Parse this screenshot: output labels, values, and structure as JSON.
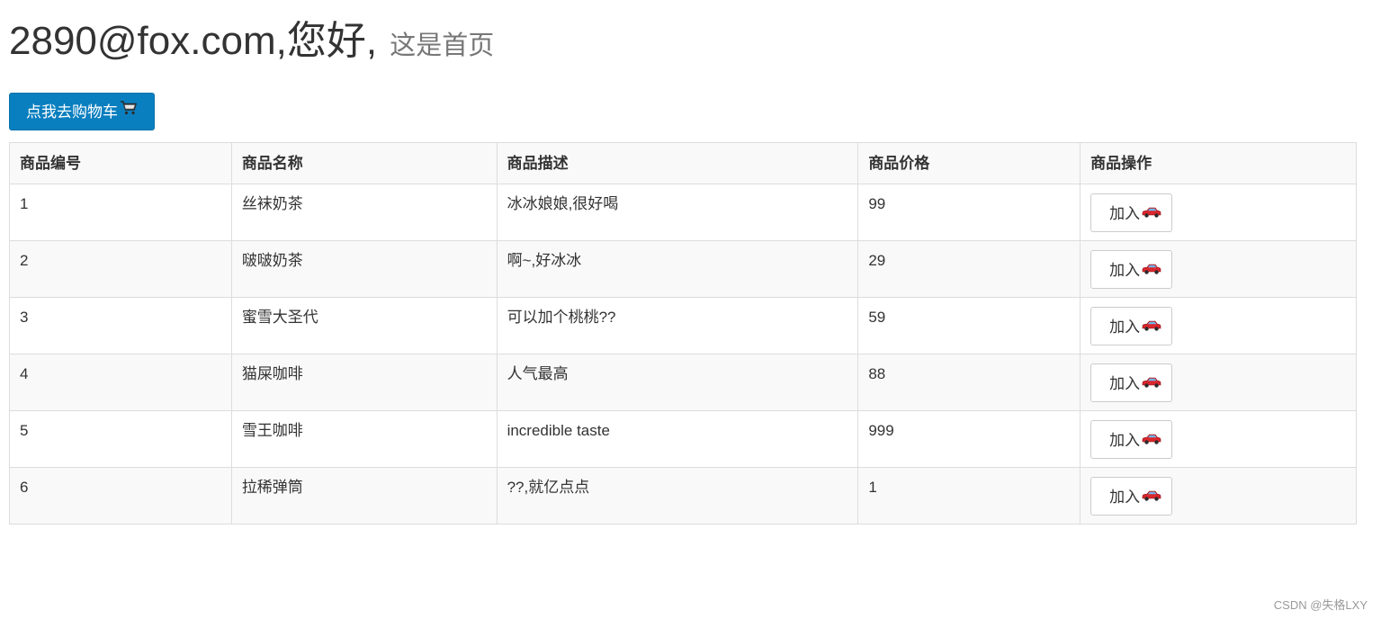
{
  "header": {
    "greeting": "2890@fox.com,您好,",
    "subtitle": "这是首页"
  },
  "cart_button": {
    "label": "点我去购物车",
    "icon": "shopping-cart-icon"
  },
  "table": {
    "headers": [
      "商品编号",
      "商品名称",
      "商品描述",
      "商品价格",
      "商品操作"
    ],
    "rows": [
      {
        "id": "1",
        "name": "丝袜奶茶",
        "desc": "冰冰娘娘,很好喝",
        "price": "99",
        "action": "加入"
      },
      {
        "id": "2",
        "name": "啵啵奶茶",
        "desc": "啊~,好冰冰",
        "price": "29",
        "action": "加入"
      },
      {
        "id": "3",
        "name": "蜜雪大圣代",
        "desc": "可以加个桃桃??",
        "price": "59",
        "action": "加入"
      },
      {
        "id": "4",
        "name": "猫屎咖啡",
        "desc": "人气最高",
        "price": "88",
        "action": "加入"
      },
      {
        "id": "5",
        "name": "雪王咖啡",
        "desc": "incredible taste",
        "price": "999",
        "action": "加入"
      },
      {
        "id": "6",
        "name": "拉稀弹筒",
        "desc": "??,就亿点点",
        "price": "1",
        "action": "加入"
      }
    ],
    "add_icon": "car-icon"
  },
  "watermark": "CSDN @失格LXY",
  "colors": {
    "primary": "#0a7fbf",
    "stripe": "#f9f9f9",
    "border": "#dddddd"
  }
}
